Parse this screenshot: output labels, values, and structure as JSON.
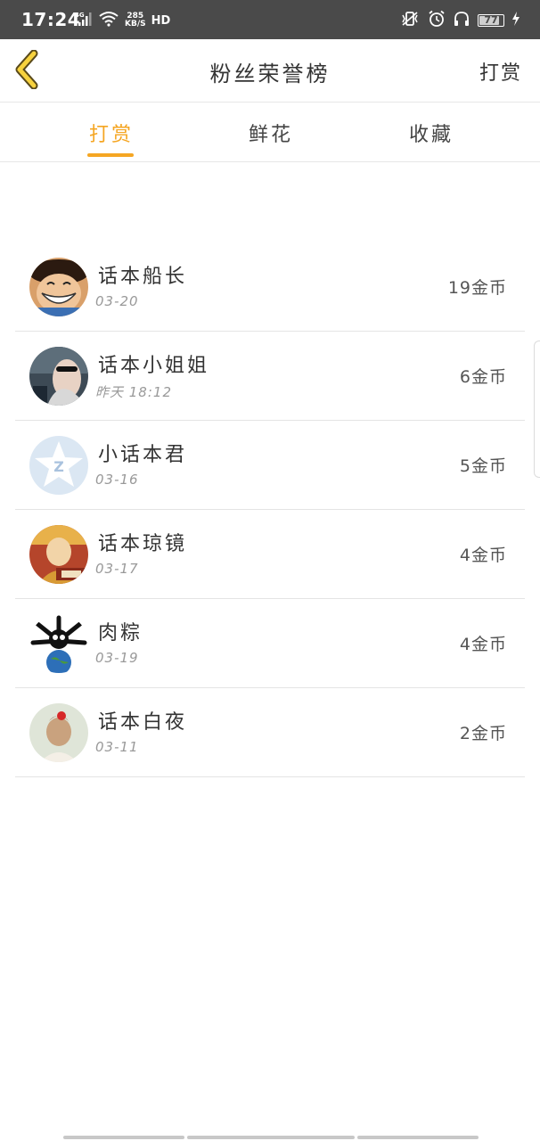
{
  "status_bar": {
    "time": "17:24",
    "network": "4G",
    "speed_value": "285",
    "speed_unit": "KB/S",
    "hd": "HD",
    "battery": "77",
    "icons": [
      "signal-icon",
      "wifi-icon",
      "vibrate-icon",
      "alarm-icon",
      "headphones-icon",
      "battery-icon",
      "charging-icon"
    ]
  },
  "header": {
    "title": "粉丝荣誉榜",
    "action_label": "打赏",
    "back_icon": "chevron-left-icon"
  },
  "tabs": [
    {
      "label": "打赏",
      "active": true
    },
    {
      "label": "鲜花",
      "active": false
    },
    {
      "label": "收藏",
      "active": false
    }
  ],
  "colors": {
    "accent": "#f5a623",
    "status_bar": "#4a4a4a"
  },
  "fans": [
    {
      "name": "话本船长",
      "date": "03-20",
      "amount": "19金币"
    },
    {
      "name": "话本小姐姐",
      "date": "昨天 18:12",
      "amount": "6金币"
    },
    {
      "name": "小话本君",
      "date": "03-16",
      "amount": "5金币"
    },
    {
      "name": "话本琼镜",
      "date": "03-17",
      "amount": "4金币"
    },
    {
      "name": "肉粽",
      "date": "03-19",
      "amount": "4金币"
    },
    {
      "name": "话本白夜",
      "date": "03-11",
      "amount": "2金币"
    }
  ]
}
